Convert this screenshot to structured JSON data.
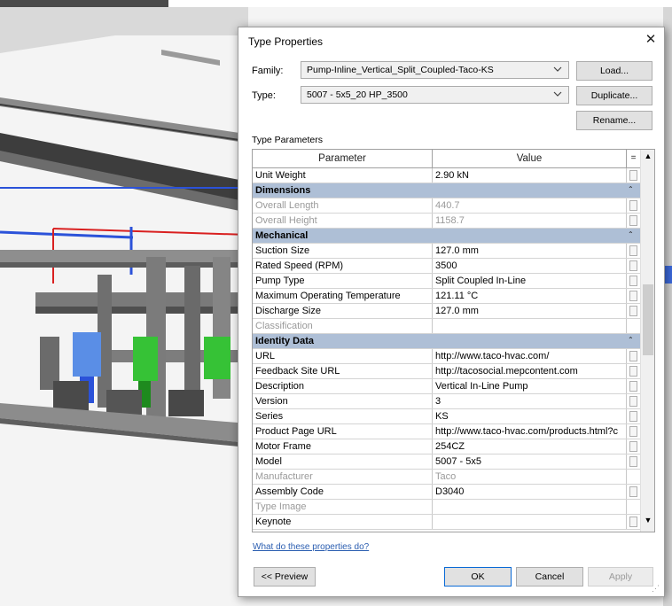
{
  "dialog": {
    "title": "Type Properties",
    "family_label": "Family:",
    "family_value": "Pump-Inline_Vertical_Split_Coupled-Taco-KS",
    "type_label": "Type:",
    "type_value": "5007 - 5x5_20 HP_3500",
    "load_label": "Load...",
    "duplicate_label": "Duplicate...",
    "rename_label": "Rename...",
    "type_parameters_label": "Type Parameters",
    "help_link": "What do these properties do?",
    "preview_label": "<< Preview",
    "ok_label": "OK",
    "cancel_label": "Cancel",
    "apply_label": "Apply"
  },
  "grid": {
    "headers": {
      "parameter": "Parameter",
      "value": "Value",
      "menu": "="
    },
    "rows": [
      {
        "kind": "row",
        "param": "Unit Weight",
        "value": "2.90 kN",
        "grey": false,
        "cell": true
      },
      {
        "kind": "group",
        "label": "Dimensions"
      },
      {
        "kind": "row",
        "param": "Overall Length",
        "value": "440.7",
        "grey": true,
        "cell": true
      },
      {
        "kind": "row",
        "param": "Overall Height",
        "value": "1158.7",
        "grey": true,
        "cell": true
      },
      {
        "kind": "group",
        "label": "Mechanical"
      },
      {
        "kind": "row",
        "param": "Suction Size",
        "value": "127.0 mm",
        "grey": false,
        "cell": true
      },
      {
        "kind": "row",
        "param": "Rated Speed (RPM)",
        "value": "3500",
        "grey": false,
        "cell": true
      },
      {
        "kind": "row",
        "param": "Pump Type",
        "value": "Split Coupled In-Line",
        "grey": false,
        "cell": true
      },
      {
        "kind": "row",
        "param": "Maximum Operating Temperature",
        "value": "121.11 °C",
        "grey": false,
        "cell": true
      },
      {
        "kind": "row",
        "param": "Discharge Size",
        "value": "127.0 mm",
        "grey": false,
        "cell": true
      },
      {
        "kind": "row",
        "param": "Classification",
        "value": "",
        "grey": true,
        "cell": false
      },
      {
        "kind": "group",
        "label": "Identity Data"
      },
      {
        "kind": "row",
        "param": "URL",
        "value": "http://www.taco-hvac.com/",
        "grey": false,
        "cell": true
      },
      {
        "kind": "row",
        "param": "Feedback Site URL",
        "value": "http://tacosocial.mepcontent.com",
        "grey": false,
        "cell": true
      },
      {
        "kind": "row",
        "param": "Description",
        "value": "Vertical In-Line Pump",
        "grey": false,
        "cell": true
      },
      {
        "kind": "row",
        "param": "Version",
        "value": "3",
        "grey": false,
        "cell": true
      },
      {
        "kind": "row",
        "param": "Series",
        "value": "KS",
        "grey": false,
        "cell": true
      },
      {
        "kind": "row",
        "param": "Product Page URL",
        "value": "http://www.taco-hvac.com/products.html?c",
        "grey": false,
        "cell": true
      },
      {
        "kind": "row",
        "param": "Motor Frame",
        "value": "254CZ",
        "grey": false,
        "cell": true
      },
      {
        "kind": "row",
        "param": "Model",
        "value": "5007 - 5x5",
        "grey": false,
        "cell": true
      },
      {
        "kind": "row",
        "param": "Manufacturer",
        "value": "Taco",
        "grey": true,
        "cell": false
      },
      {
        "kind": "row",
        "param": "Assembly Code",
        "value": "D3040",
        "grey": false,
        "cell": true
      },
      {
        "kind": "row",
        "param": "Type Image",
        "value": "",
        "grey": true,
        "cell": false
      },
      {
        "kind": "row",
        "param": "Keynote",
        "value": "",
        "grey": false,
        "cell": true
      }
    ]
  },
  "colors": {
    "group_header": "#aebfd6",
    "link": "#2a5db0",
    "pipe_blue": "#2b52d9",
    "pipe_red": "#d92020",
    "pump_blue": "#5a8ee6",
    "pump_green": "#36c236"
  },
  "icons": {
    "close": "close-icon",
    "dropdown": "chevron-down-icon",
    "collapse": "double-chevron-up-icon",
    "scroll_up": "arrow-up-icon",
    "scroll_down": "arrow-down-icon"
  }
}
